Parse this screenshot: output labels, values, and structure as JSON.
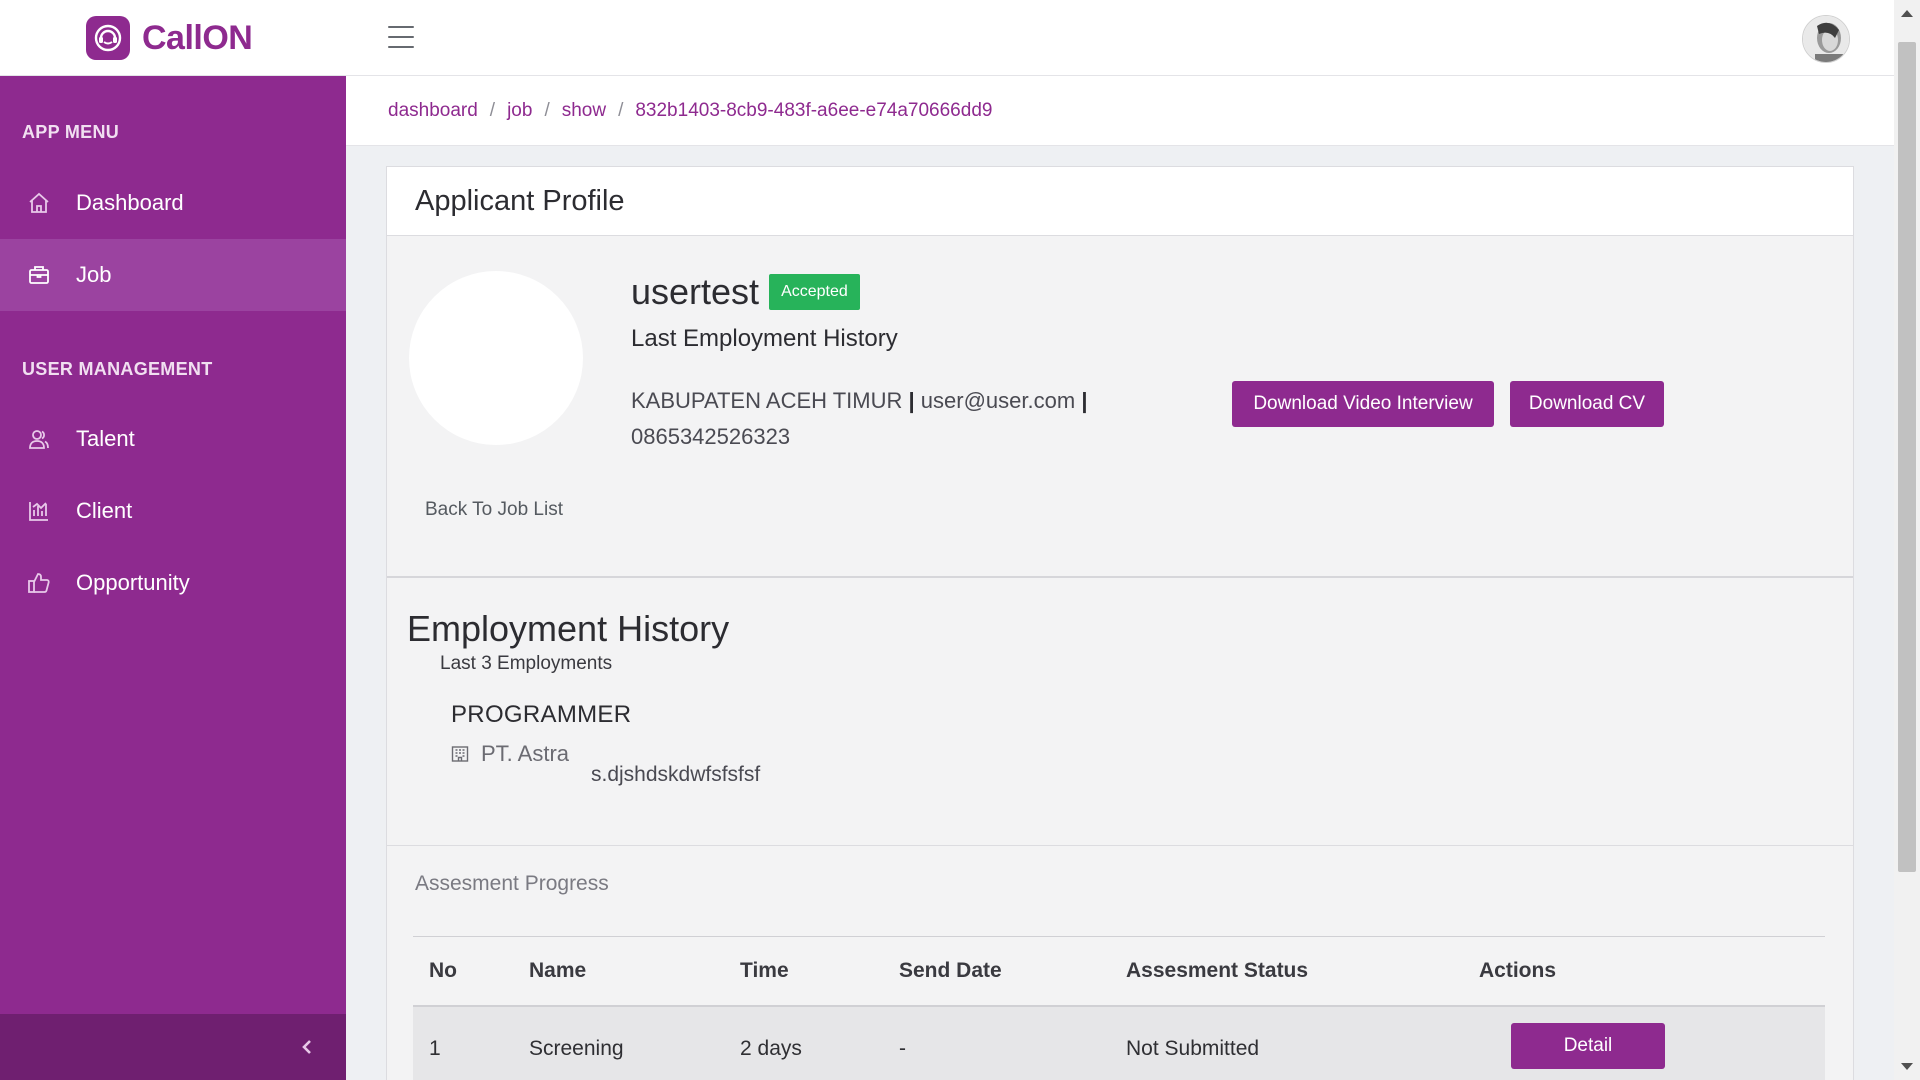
{
  "app": {
    "name": "CallON",
    "brand_color": "#8e2a8f",
    "accent_green": "#27b35a"
  },
  "header": {
    "menu_icon": "hamburger-icon",
    "avatar": "user-avatar"
  },
  "sidebar": {
    "sections": [
      {
        "title": "APP MENU"
      },
      {
        "title": "USER MANAGEMENT"
      }
    ],
    "items": [
      {
        "label": "Dashboard",
        "icon": "home-icon",
        "active": false
      },
      {
        "label": "Job",
        "icon": "briefcase-icon",
        "active": true
      },
      {
        "label": "Talent",
        "icon": "users-icon",
        "active": false
      },
      {
        "label": "Client",
        "icon": "chart-icon",
        "active": false
      },
      {
        "label": "Opportunity",
        "icon": "thumbs-up-icon",
        "active": false
      }
    ],
    "collapse_icon": "chevron-left-icon"
  },
  "breadcrumb": [
    "dashboard",
    "job",
    "show",
    "832b1403-8cb9-483f-a6ee-e74a70666dd9"
  ],
  "profile": {
    "card_title": "Applicant Profile",
    "username": "usertest",
    "status": "Accepted",
    "subtitle": "Last Employment History",
    "location": "KABUPATEN ACEH TIMUR",
    "separator": "|",
    "email": "user@user.com",
    "phone": "0865342526323",
    "download_video_label": "Download Video Interview",
    "download_cv_label": "Download CV",
    "back_label": "Back To Job List"
  },
  "employment": {
    "title": "Employment History",
    "subtitle": "Last 3 Employments",
    "jobs": [
      {
        "position": "PROGRAMMER",
        "company": "PT. Astra",
        "company_icon": "building-icon",
        "description": "s.djshdskdwfsfsfsf"
      }
    ]
  },
  "assessment": {
    "title": "Assesment Progress",
    "columns": [
      "No",
      "Name",
      "Time",
      "Send Date",
      "Assesment Status",
      "Actions"
    ],
    "rows": [
      {
        "no": "1",
        "name": "Screening",
        "time": "2 days",
        "send_date": "-",
        "status": "Not Submitted",
        "action_label": "Detail"
      }
    ]
  }
}
